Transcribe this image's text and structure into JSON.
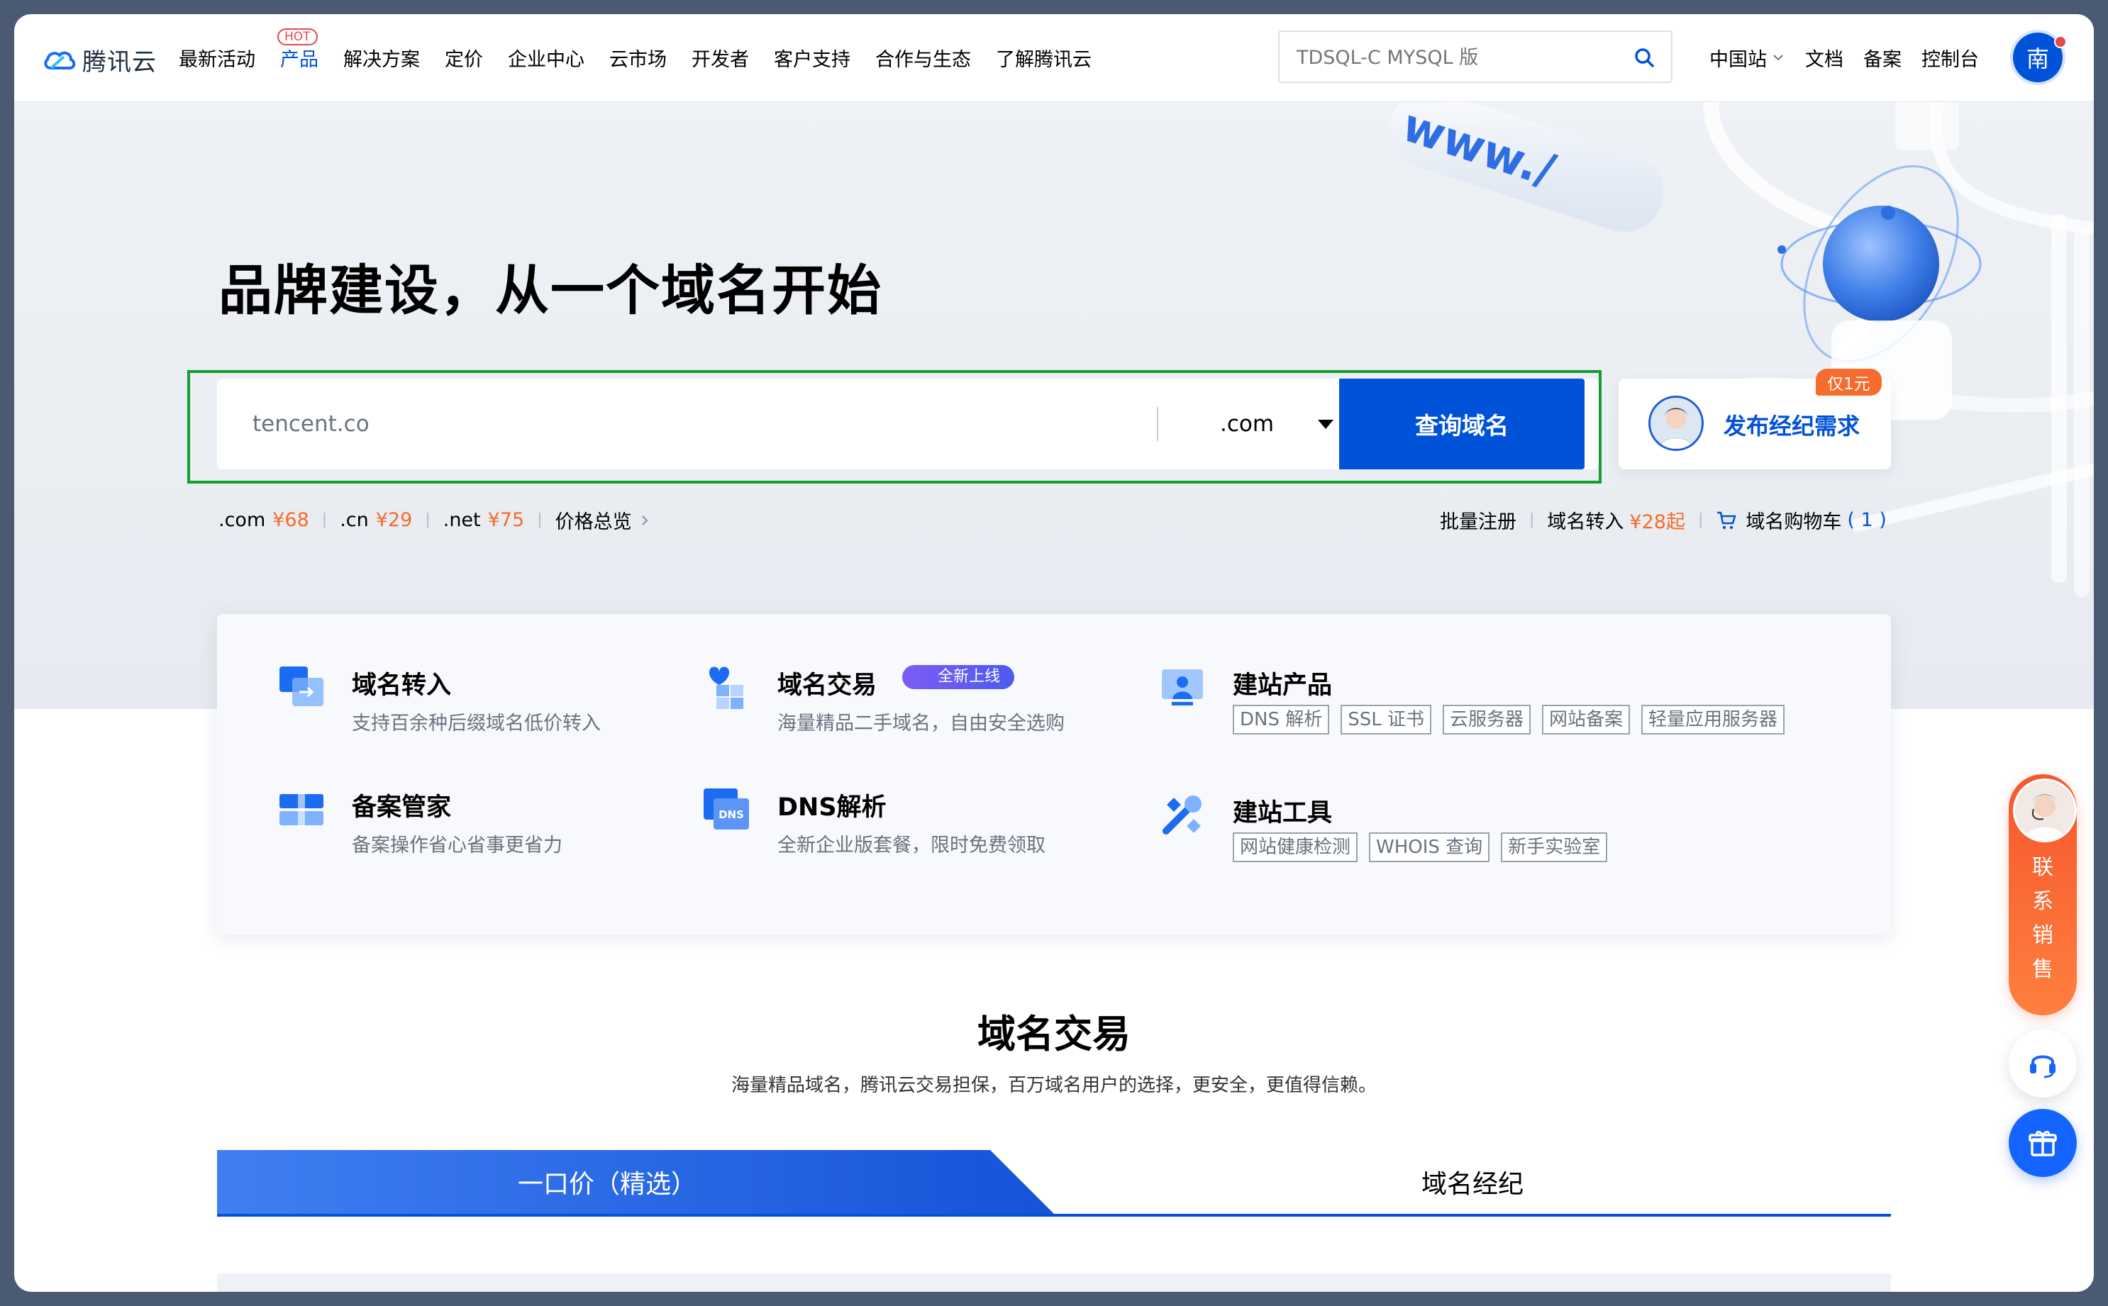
{
  "nav": {
    "logo_text": "腾讯云",
    "items": [
      "最新活动",
      "产品",
      "解决方案",
      "定价",
      "企业中心",
      "云市场",
      "开发者",
      "客户支持",
      "合作与生态",
      "了解腾讯云"
    ],
    "hot_badge": "HOT",
    "search_placeholder": "TDSQL-C MYSQL 版",
    "region": "中国站",
    "docs": "文档",
    "beian": "备案",
    "console": "控制台",
    "avatar_char": "南"
  },
  "hero": {
    "title": "品牌建设，从一个域名开始",
    "input_value": "tencent.co",
    "suffix": ".com",
    "query_button": "查询域名",
    "broker_badge": "仅1元",
    "broker_label": "发布经纪需求",
    "deco_text": "www./",
    "prices": [
      {
        "suffix": ".com",
        "price": "¥68"
      },
      {
        "suffix": ".cn",
        "price": "¥29"
      },
      {
        "suffix": ".net",
        "price": "¥75"
      }
    ],
    "price_overview": "价格总览",
    "bulk_register": "批量注册",
    "transfer": "域名转入",
    "transfer_price": "¥28起",
    "cart": "域名购物车",
    "cart_count": "( 1 )"
  },
  "products": {
    "transfer": {
      "title": "域名转入",
      "desc": "支持百余种后缀域名低价转入"
    },
    "trade": {
      "title": "域名交易",
      "badge": "全新上线",
      "desc": "海量精品二手域名，自由安全选购"
    },
    "site": {
      "title": "建站产品",
      "tags": [
        "DNS 解析",
        "SSL 证书",
        "云服务器",
        "网站备案",
        "轻量应用服务器"
      ]
    },
    "beian": {
      "title": "备案管家",
      "desc": "备案操作省心省事更省力"
    },
    "dns": {
      "title": "DNS解析",
      "desc": "全新企业版套餐，限时免费领取",
      "icon_text": "DNS"
    },
    "tools": {
      "title": "建站工具",
      "tags": [
        "网站健康检测",
        "WHOIS 查询",
        "新手实验室"
      ]
    }
  },
  "section": {
    "title": "域名交易",
    "subtitle": "海量精品域名，腾讯云交易担保，百万域名用户的选择，更安全，更值得信赖。",
    "tab_active": "一口价（精选）",
    "tab_other": "域名经纪"
  },
  "float": {
    "sales_text": [
      "联",
      "系",
      "销",
      "售"
    ]
  },
  "colors": {
    "brand_blue": "#0052d9",
    "accent_orange": "#f56c2c",
    "highlight_green": "#169c2f"
  }
}
